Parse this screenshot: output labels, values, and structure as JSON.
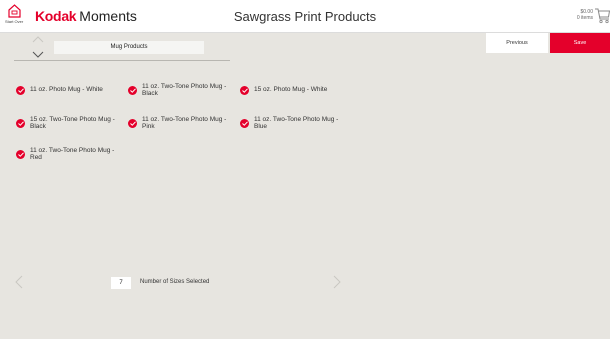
{
  "header": {
    "home_label": "Start Over",
    "brand_kodak": "Kodak",
    "brand_moments": "Moments",
    "title": "Sawgrass Print Products",
    "cart_amount": "$0.00",
    "cart_items": "0 items"
  },
  "category": {
    "label": "Mug Products"
  },
  "actions": {
    "previous": "Previous",
    "save": "Save"
  },
  "options": [
    {
      "label": "11 oz. Photo Mug - White",
      "selected": true
    },
    {
      "label": "11 oz. Two-Tone Photo Mug - Black",
      "selected": true
    },
    {
      "label": "15 oz. Photo Mug - White",
      "selected": true
    },
    {
      "label": "15 oz. Two-Tone Photo Mug - Black",
      "selected": true
    },
    {
      "label": "11 oz. Two-Tone Photo Mug - Pink",
      "selected": true
    },
    {
      "label": "11 oz. Two-Tone Photo Mug - Blue",
      "selected": true
    },
    {
      "label": "11 oz. Two-Tone Photo Mug - Red",
      "selected": true
    }
  ],
  "footer": {
    "count": "7",
    "count_label": "Number of Sizes Selected"
  },
  "colors": {
    "accent": "#e4002b",
    "background": "#e7e5e0"
  },
  "icons": [
    "home-icon",
    "cart-icon",
    "chevron-up-icon",
    "chevron-down-icon",
    "chevron-left-icon",
    "chevron-right-icon",
    "check-icon"
  ]
}
